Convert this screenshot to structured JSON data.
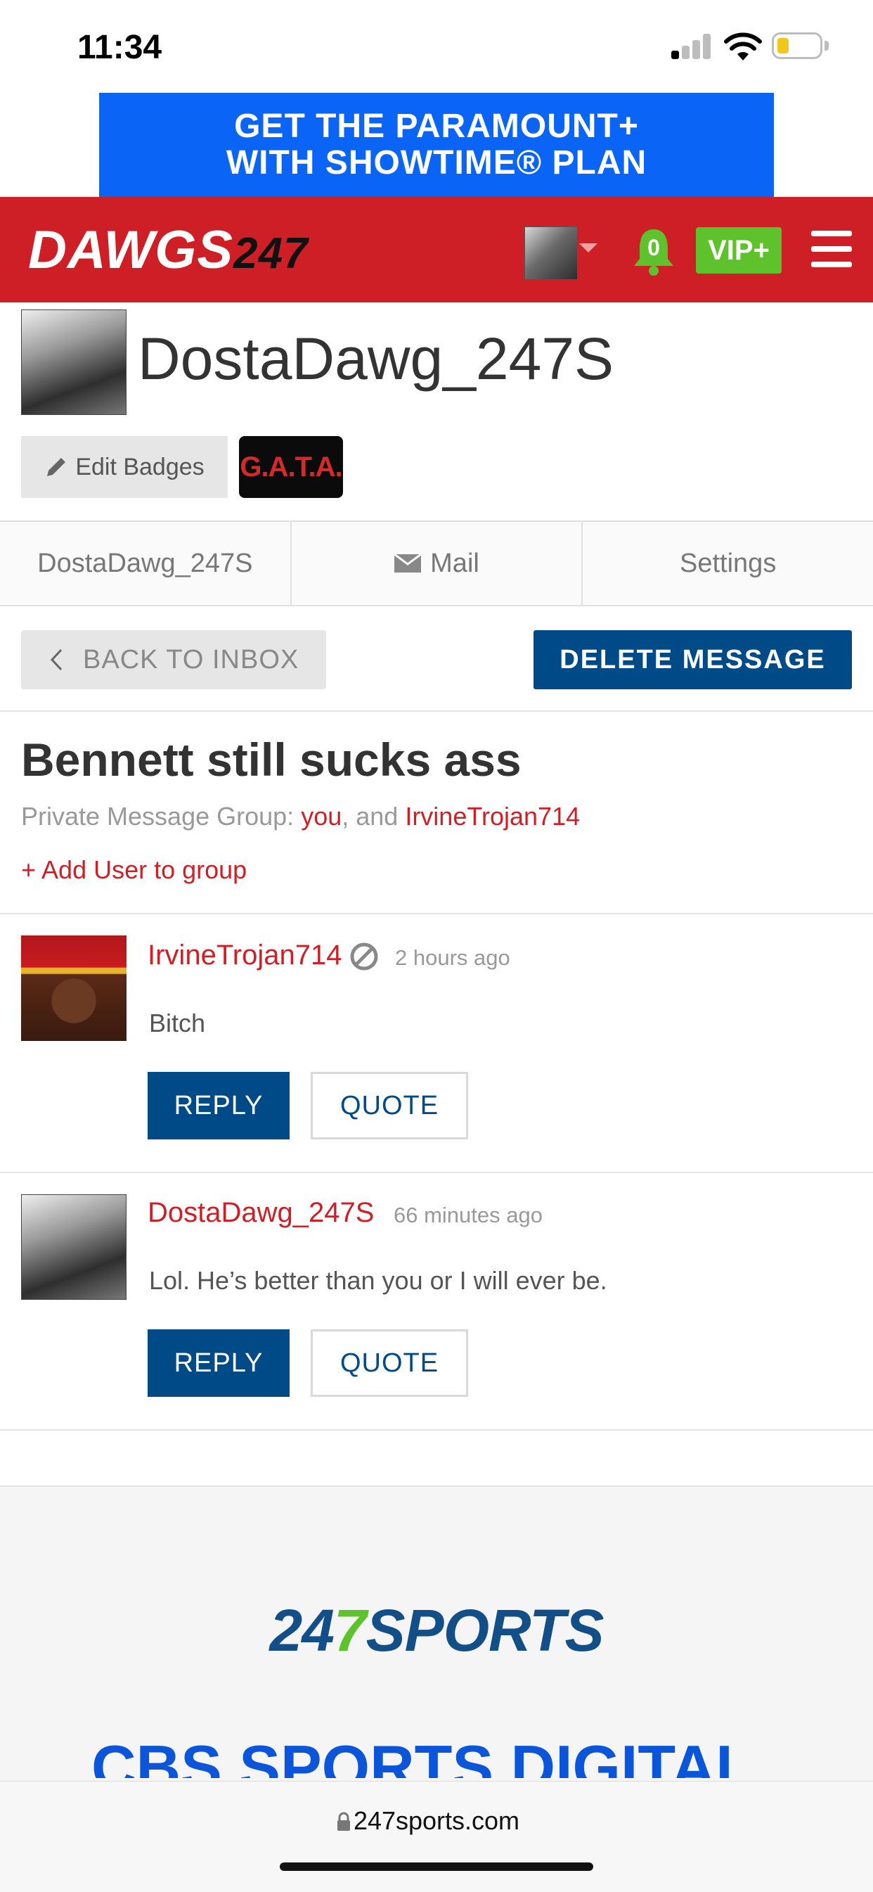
{
  "status_bar": {
    "time": "11:34"
  },
  "ad": {
    "line1": "GET THE PARAMOUNT+",
    "line2": "WITH SHOWTIME® PLAN"
  },
  "header": {
    "brand_text": "DAWGS",
    "brand_number": "247",
    "notification_count": "0",
    "vip_label": "VIP+",
    "icons": [
      "user-avatar",
      "caret-down-icon",
      "bell-icon",
      "menu-icon"
    ]
  },
  "profile": {
    "username": "DostaDawg_247S",
    "edit_badges_label": "Edit Badges",
    "badge_text": "G.A.T.A."
  },
  "tabs": [
    {
      "label": "DostaDawg_247S"
    },
    {
      "label": "Mail",
      "icon": "mail-icon"
    },
    {
      "label": "Settings"
    }
  ],
  "actions": {
    "back_label": "BACK TO INBOX",
    "delete_label": "DELETE MESSAGE"
  },
  "thread": {
    "subject": "Bennett still sucks ass",
    "group_prefix": "Private Message Group: ",
    "group_you": "you",
    "group_sep": ", and ",
    "group_user": "IrvineTrojan714",
    "add_user_label": "+ Add User to group"
  },
  "messages": [
    {
      "author": "IrvineTrojan714",
      "time": "2 hours ago",
      "body": "Bitch",
      "reply_label": "REPLY",
      "quote_label": "QUOTE"
    },
    {
      "author": "DostaDawg_247S",
      "time": "66 minutes ago",
      "body": "Lol. He’s better than you or I will ever be.",
      "reply_label": "REPLY",
      "quote_label": "QUOTE"
    }
  ],
  "footer": {
    "logo_prefix": "24",
    "logo_seven": "7",
    "logo_suffix": "SPORTS",
    "cbs_text": "CBS SPORTS DIGITAL"
  },
  "browser": {
    "url": "247sports.com"
  },
  "colors": {
    "brand_red": "#cf1f26",
    "navy": "#004b87",
    "vip_green": "#5dc22b",
    "ad_blue": "#0a64f5"
  }
}
